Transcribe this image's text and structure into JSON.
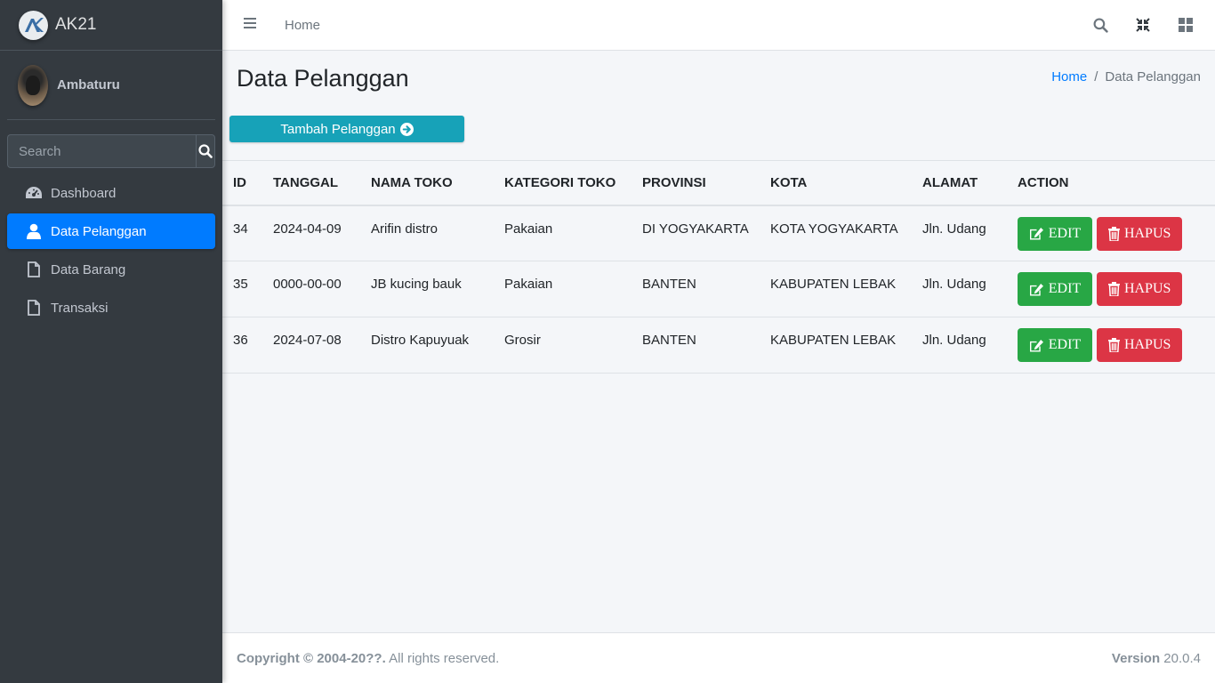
{
  "brand": {
    "name": "AK21",
    "logo_text": "AK"
  },
  "user": {
    "name": "Ambaturu"
  },
  "search": {
    "placeholder": "Search"
  },
  "sidebar": {
    "items": [
      {
        "label": "Dashboard",
        "icon": "tachometer-icon",
        "active": false
      },
      {
        "label": "Data Pelanggan",
        "icon": "user-icon",
        "active": true
      },
      {
        "label": "Data Barang",
        "icon": "file-icon",
        "active": false
      },
      {
        "label": "Transaksi",
        "icon": "file-icon",
        "active": false
      }
    ]
  },
  "topbar": {
    "home_label": "Home"
  },
  "page": {
    "title": "Data Pelanggan",
    "breadcrumb": {
      "home": "Home",
      "separator": "/",
      "current": "Data Pelanggan"
    },
    "add_button": "Tambah Pelanggan"
  },
  "table": {
    "headers": [
      "ID",
      "TANGGAL",
      "NAMA TOKO",
      "KATEGORI TOKO",
      "PROVINSI",
      "KOTA",
      "ALAMAT",
      "ACTION"
    ],
    "rows": [
      {
        "id": "34",
        "tanggal": "2024-04-09",
        "nama": "Arifin distro",
        "kategori": "Pakaian",
        "provinsi": "DI YOGYAKARTA",
        "kota": "KOTA YOGYAKARTA",
        "alamat": "Jln. Udang"
      },
      {
        "id": "35",
        "tanggal": "0000-00-00",
        "nama": "JB kucing bauk",
        "kategori": "Pakaian",
        "provinsi": "BANTEN",
        "kota": "KABUPATEN LEBAK",
        "alamat": "Jln. Udang"
      },
      {
        "id": "36",
        "tanggal": "2024-07-08",
        "nama": "Distro Kapuyuak",
        "kategori": "Grosir",
        "provinsi": "BANTEN",
        "kota": "KABUPATEN LEBAK",
        "alamat": "Jln. Udang"
      }
    ],
    "edit_label": "EDIT",
    "delete_label": "HAPUS"
  },
  "footer": {
    "copyright_bold": "Copyright © 2004-20??.",
    "copyright_rest": " All rights reserved.",
    "version_label": "Version",
    "version_value": " 20.0.4"
  },
  "colors": {
    "sidebar": "#343a40",
    "primary": "#007bff",
    "info": "#17a2b8",
    "success": "#28a745",
    "danger": "#dc3545"
  }
}
